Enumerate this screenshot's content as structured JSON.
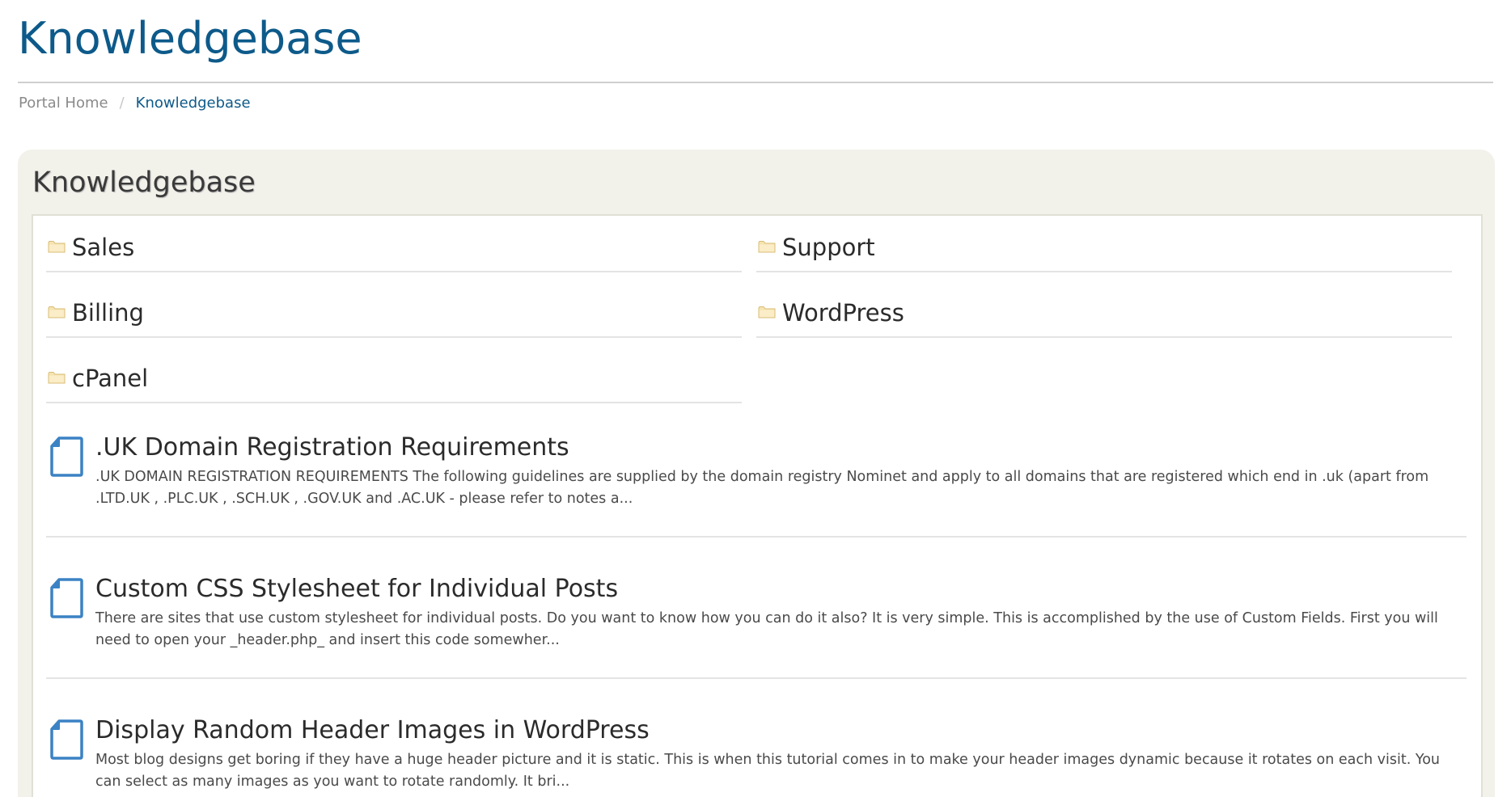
{
  "page": {
    "title": "Knowledgebase"
  },
  "breadcrumb": {
    "items": [
      {
        "label": "Portal Home"
      },
      {
        "label": "Knowledgebase"
      }
    ],
    "separator": "/"
  },
  "panel": {
    "heading": "Knowledgebase"
  },
  "categories": [
    {
      "label": "Sales"
    },
    {
      "label": "Support"
    },
    {
      "label": "Billing"
    },
    {
      "label": "WordPress"
    },
    {
      "label": "cPanel"
    }
  ],
  "articles": [
    {
      "title": ".UK Domain Registration Requirements",
      "snippet": ".UK DOMAIN REGISTRATION REQUIREMENTS The following guidelines are supplied by the domain registry Nominet and apply to all domains that are registered which end in .uk (apart from .LTD.UK , .PLC.UK , .SCH.UK , .GOV.UK and .AC.UK - please refer to notes a..."
    },
    {
      "title": "Custom CSS Stylesheet for Individual Posts",
      "snippet": "There are sites that use custom stylesheet for individual posts. Do you want to know how you can do it also? It is very simple. This is accomplished by the use of Custom Fields. First you will need to open your _header.php_ and insert this code somewher..."
    },
    {
      "title": "Display Random Header Images in WordPress",
      "snippet": "Most blog designs get boring if they have a huge header picture and it is static. This is when this tutorial comes in to make your header images dynamic because it rotates on each visit. You can select as many images as you want to rotate randomly. It bri..."
    }
  ],
  "icons": {
    "category": "folder-icon",
    "article": "document-icon"
  },
  "colors": {
    "title": "#0d5a8a",
    "link": "#0d5a8a",
    "panel_bg": "#f2f1ea",
    "doc_icon": "#3b82c4",
    "folder_icon": "#f4dfa6"
  }
}
